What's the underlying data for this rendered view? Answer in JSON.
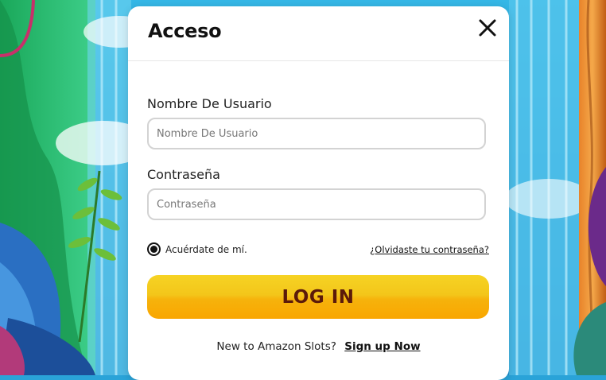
{
  "modal": {
    "title": "Acceso",
    "close_icon": "close-icon"
  },
  "form": {
    "username_label": "Nombre De Usuario",
    "username_placeholder": "Nombre De Usuario",
    "username_value": "",
    "password_label": "Contraseña",
    "password_placeholder": "Contraseña",
    "password_value": "",
    "remember_label": "Acuérdate de mí.",
    "remember_checked": true,
    "forgot_link": "¿Olvidaste tu contraseña?",
    "login_button": "LOG IN"
  },
  "footer": {
    "signup_prompt": "New to Amazon Slots?",
    "signup_link": "Sign up Now"
  },
  "colors": {
    "button_gradient_top": "#f6d324",
    "button_gradient_bottom": "#f9a600",
    "button_text": "#5b1a0a",
    "background": "#2aa3d8"
  }
}
